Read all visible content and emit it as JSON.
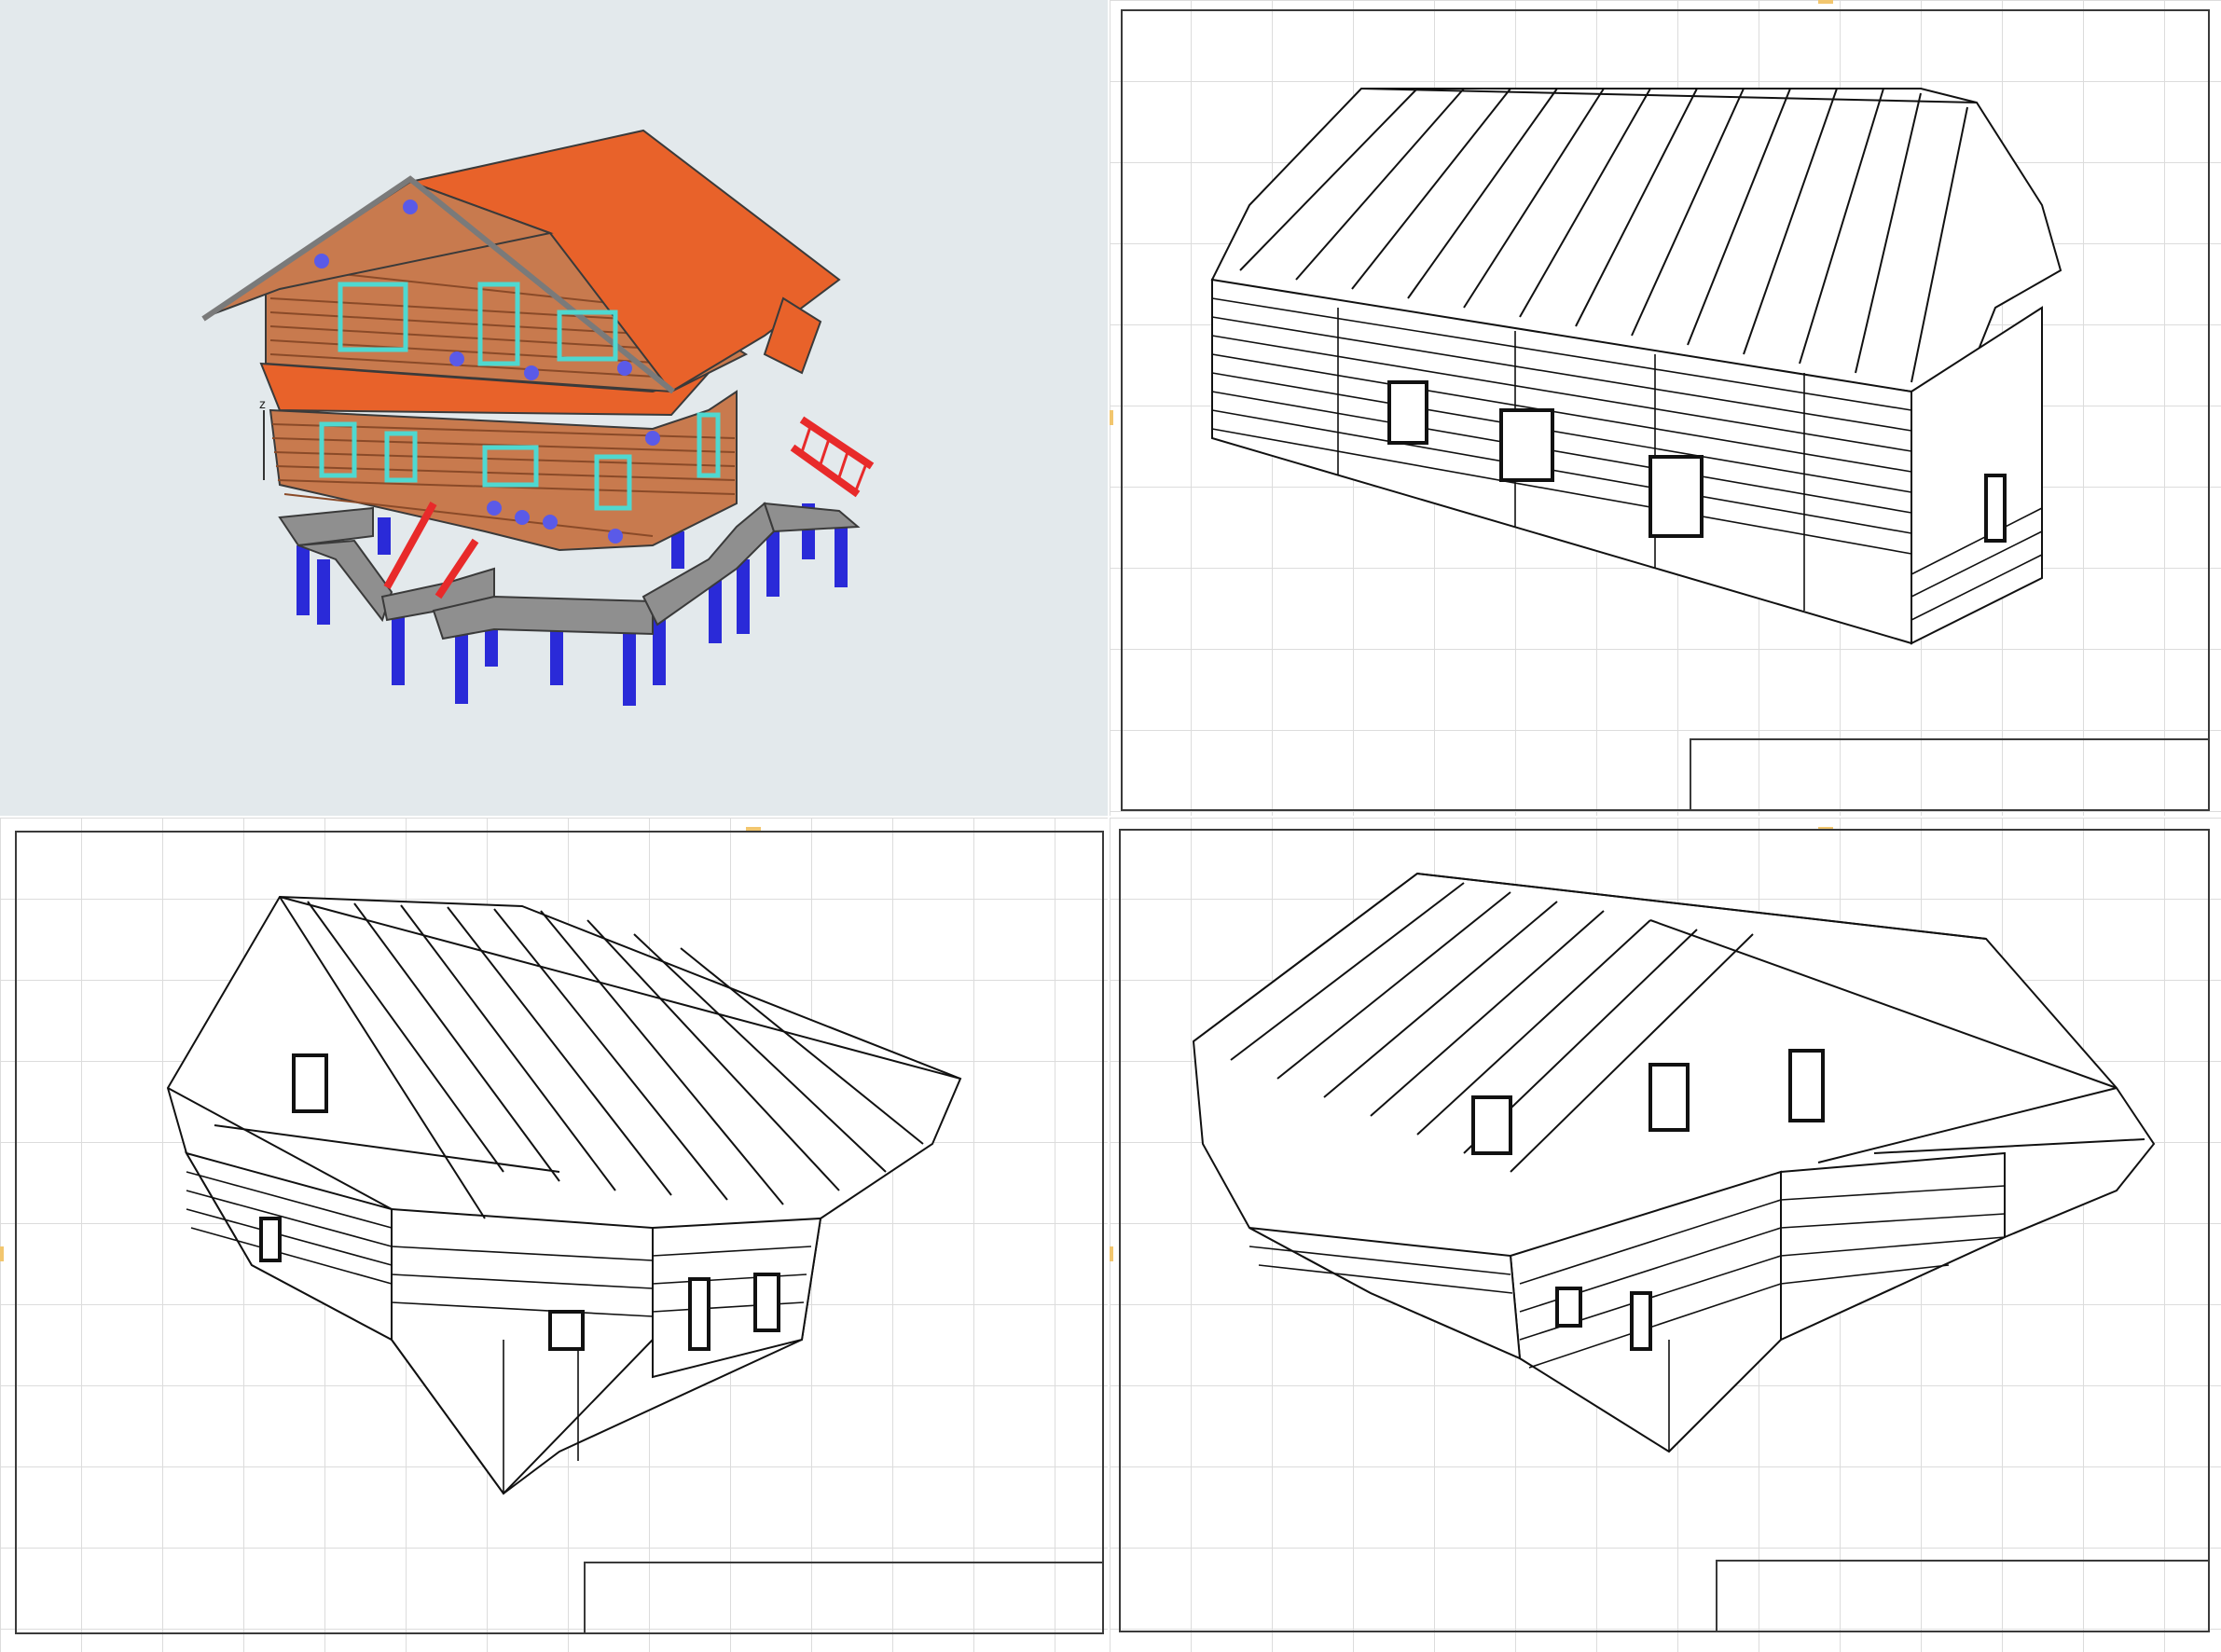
{
  "panes": [
    {
      "id": "pane-3d",
      "kind": "3D colored model view"
    },
    {
      "id": "pane-tr",
      "kind": "layout sheet, hidden-line view"
    },
    {
      "id": "pane-bl",
      "kind": "layout sheet, hidden-line view"
    },
    {
      "id": "pane-br",
      "kind": "layout sheet, hidden-line view"
    }
  ],
  "axis_indicator": {
    "z": "z"
  },
  "colors": {
    "viewport_bg": "#e3e9ec",
    "roof": "#e8622a",
    "logs": "#c87a4e",
    "window_frames": "#4fd8d0",
    "piles": "#2a2ad8",
    "stairs": "#e82a2a",
    "foundation": "#8f8f8f",
    "sheet_grid": "#dcdcdc",
    "sheet_frame": "#3a3a3a",
    "sheet_marker": "#f2c66e"
  }
}
